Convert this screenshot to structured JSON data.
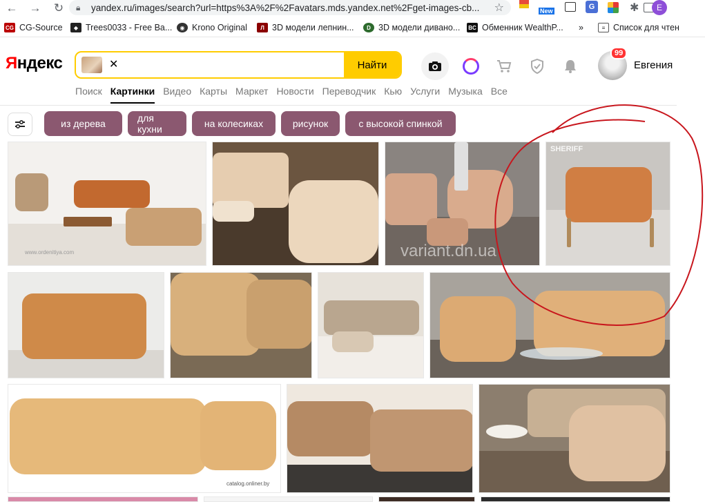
{
  "browser": {
    "url": "yandex.ru/images/search?url=https%3A%2F%2Favatars.mds.yandex.net%2Fget-images-cb...",
    "new_badge": "New",
    "translate_icon": "G",
    "profile_initial": "E",
    "bookmarks": [
      {
        "label": "CG-Source",
        "icon_text": "CG",
        "color": "#b00"
      },
      {
        "label": "Trees0033 - Free Ba...",
        "icon_text": "◆",
        "color": "#222"
      },
      {
        "label": "Krono Original",
        "icon_text": "◉",
        "color": "#333"
      },
      {
        "label": "3D модели лепнин...",
        "icon_text": "Л",
        "color": "#8b0000"
      },
      {
        "label": "3D модели дивано...",
        "icon_text": "D",
        "color": "#2d6a2d"
      },
      {
        "label": "Обменник WealthP...",
        "icon_text": "BC",
        "color": "#111"
      },
      {
        "label": "»",
        "icon_text": "",
        "color": "#fff"
      },
      {
        "label": "Список для чтен",
        "icon_text": "≡",
        "color": "#555"
      }
    ]
  },
  "header": {
    "logo_first": "Я",
    "logo_rest": "ндекс",
    "search_button": "Найти",
    "badge_count": "99",
    "username": "Евгения",
    "icons": [
      "camera-icon",
      "alice-icon",
      "cart-icon",
      "shield-icon",
      "bell-icon"
    ]
  },
  "services": [
    "Поиск",
    "Картинки",
    "Видео",
    "Карты",
    "Маркет",
    "Новости",
    "Переводчик",
    "Кью",
    "Услуги",
    "Музыка",
    "Все"
  ],
  "active_service": "Картинки",
  "filters": [
    "из дерева",
    "для кухни",
    "на колесиках",
    "рисунок",
    "с высокой спинкой"
  ],
  "watermarks": {
    "tile3": "variant.dn.ua",
    "tile4": "SHERIFF",
    "tile1": "www.ordenitiya.com",
    "tile9": "catalog.onliner.by"
  },
  "colors": {
    "yandex_yellow": "#ffcc00",
    "tag_bg": "#8b5870",
    "annotation_red": "#c8161d"
  }
}
